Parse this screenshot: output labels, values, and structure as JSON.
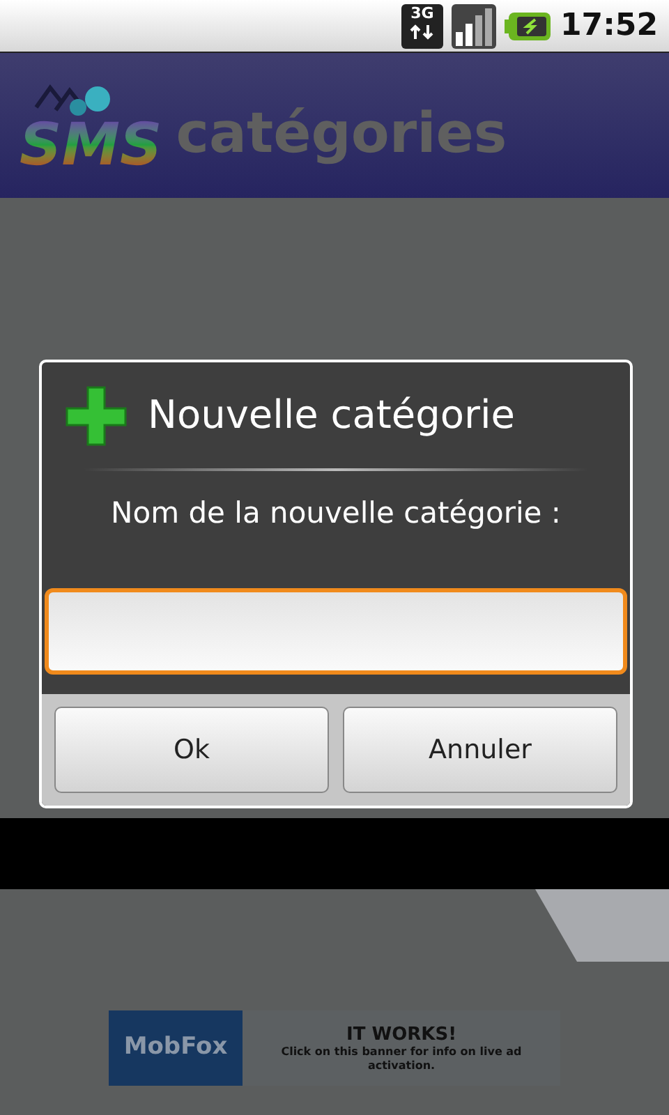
{
  "status_bar": {
    "network": "3G",
    "time": "17:52"
  },
  "header": {
    "logo": "SMS",
    "title": "catégories"
  },
  "dialog": {
    "title": "Nouvelle catégorie",
    "message": "Nom de la nouvelle catégorie :",
    "input": {
      "focused": true
    },
    "buttons": [
      "Ok",
      "Annuler"
    ]
  },
  "ad": {
    "brand": "MobFox",
    "headline": "IT WORKS!",
    "text": "Click on this banner for info on live ad activation."
  }
}
